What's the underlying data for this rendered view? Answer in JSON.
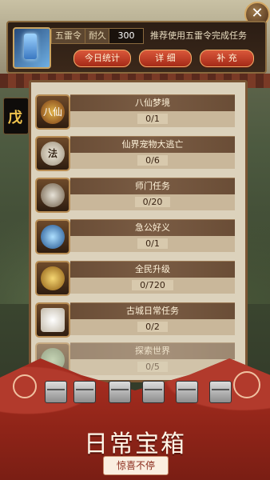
{
  "header": {
    "token_label": "五雷令",
    "durability_label": "耐久",
    "durability_value": "300",
    "recommend_text": "推荐使用五雷令完成任务",
    "buttons": [
      "今日统计",
      "详 细",
      "补 充"
    ]
  },
  "close_label": "✕",
  "side_tab_label": "戊",
  "tasks": [
    {
      "name": "八仙梦境",
      "progress": "0/1",
      "icon": "eight-immortals-icon",
      "icon_text": "八仙"
    },
    {
      "name": "仙界宠物大逃亡",
      "progress": "0/6",
      "icon": "pet-escape-icon",
      "icon_text": "法"
    },
    {
      "name": "师门任务",
      "progress": "0/20",
      "icon": "sword-icon",
      "icon_text": ""
    },
    {
      "name": "急公好义",
      "progress": "0/1",
      "icon": "blue-orb-icon",
      "icon_text": ""
    },
    {
      "name": "全民升级",
      "progress": "0/720",
      "icon": "level-up-icon",
      "icon_text": ""
    },
    {
      "name": "古城日常任务",
      "progress": "0/2",
      "icon": "ancient-city-icon",
      "icon_text": ""
    },
    {
      "name": "探索世界",
      "progress": "0/5",
      "icon": "explore-world-icon",
      "icon_text": ""
    }
  ],
  "banner": {
    "title": "日常宝箱",
    "subtitle": "惊喜不停"
  },
  "colors": {
    "accent_red": "#a52d20",
    "panel_bg": "#dcd2bc",
    "button_red": "#d9573a"
  }
}
